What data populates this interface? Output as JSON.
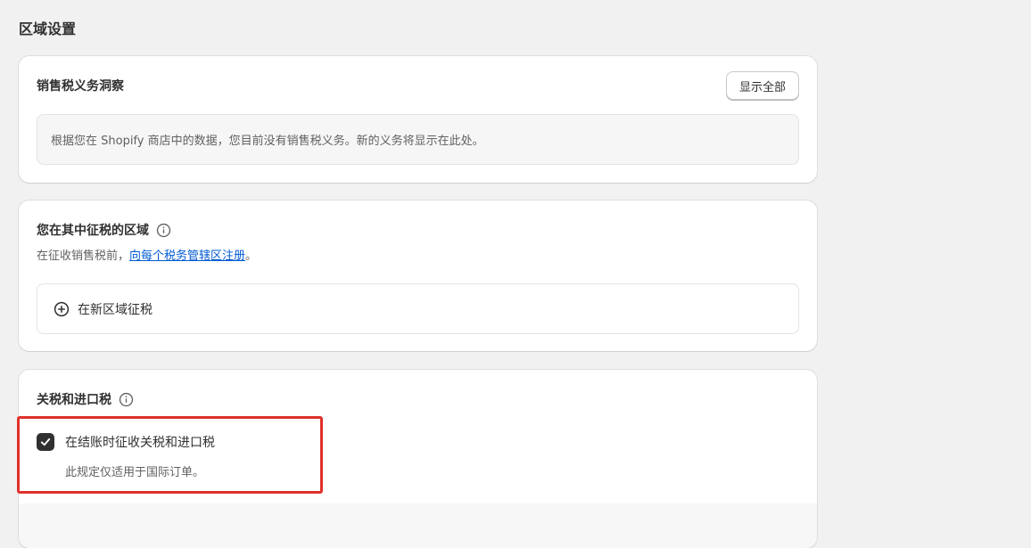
{
  "page": {
    "title": "区域设置"
  },
  "sales_tax_card": {
    "title": "销售税义务洞察",
    "show_all_label": "显示全部",
    "info_text": "根据您在 Shopify 商店中的数据，您目前没有销售税义务。新的义务将显示在此处。"
  },
  "regions_card": {
    "title": "您在其中征税的区域",
    "info_icon": "info-icon",
    "subtitle_prefix": "在征收销售税前，",
    "subtitle_link": "向每个税务管辖区注册",
    "subtitle_suffix": "。",
    "add_region_label": "在新区域征税",
    "add_icon": "plus-circle-icon"
  },
  "duties_card": {
    "title": "关税和进口税",
    "info_icon": "info-icon",
    "checkbox_label": "在结账时征收关税和进口税",
    "checkbox_checked": true,
    "helper_text": "此规定仅适用于国际订单。"
  },
  "colors": {
    "background": "#f1f1f1",
    "card": "#ffffff",
    "link": "#005bd3",
    "checkbox": "#303030",
    "highlight": "#e0312b"
  }
}
